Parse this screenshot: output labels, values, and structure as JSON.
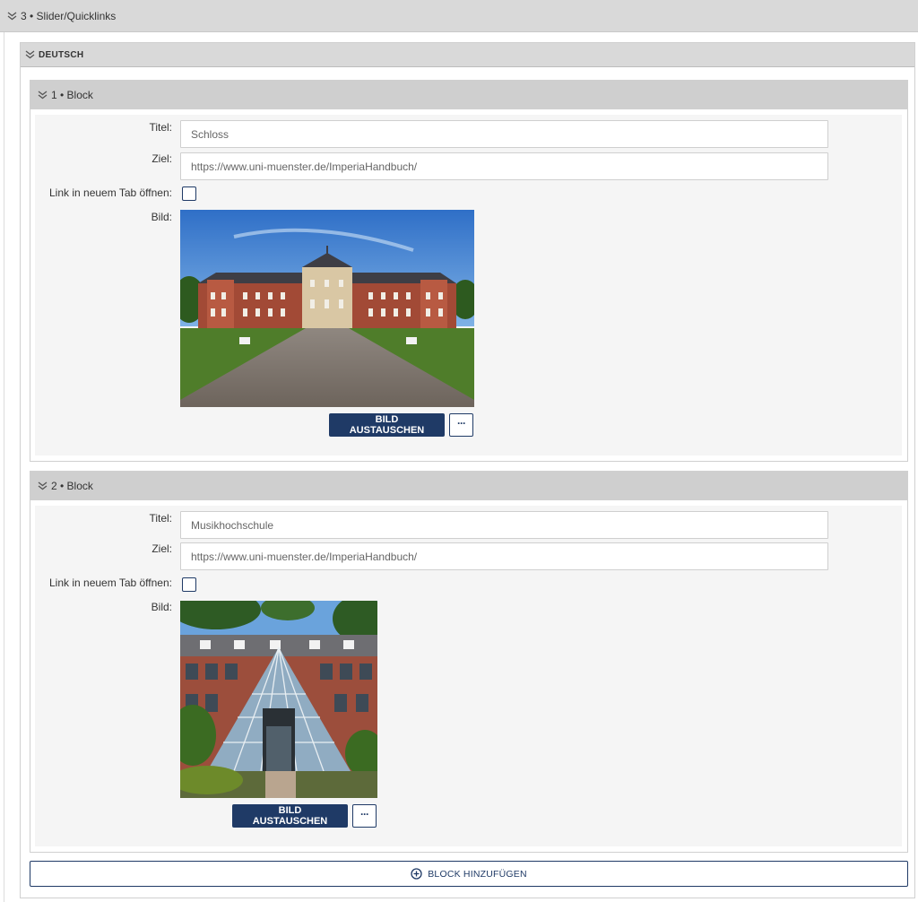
{
  "section": {
    "title": "3 • Slider/Quicklinks"
  },
  "language": {
    "title": "DEUTSCH"
  },
  "labels": {
    "title": "Titel:",
    "target": "Ziel:",
    "new_tab": "Link in neuem Tab öffnen:",
    "image": "Bild:"
  },
  "blocks": [
    {
      "header": "1 • Block",
      "title_value": "Schloss",
      "target_value": "https://www.uni-muenster.de/ImperiaHandbuch/",
      "new_tab_checked": false,
      "replace_label": "BILD AUSTAUSCHEN",
      "more_label": "···"
    },
    {
      "header": "2 • Block",
      "title_value": "Musikhochschule",
      "target_value": "https://www.uni-muenster.de/ImperiaHandbuch/",
      "new_tab_checked": false,
      "replace_label": "BILD AUSTAUSCHEN",
      "more_label": "···"
    }
  ],
  "add_block": {
    "label": "BLOCK HINZUFÜGEN"
  },
  "icons": {
    "collapse": "double-chevron-down-icon",
    "add": "circle-plus-icon"
  },
  "colors": {
    "accent": "#1f3a66",
    "bar": "#d9d9d9",
    "panel": "#f5f5f5"
  }
}
